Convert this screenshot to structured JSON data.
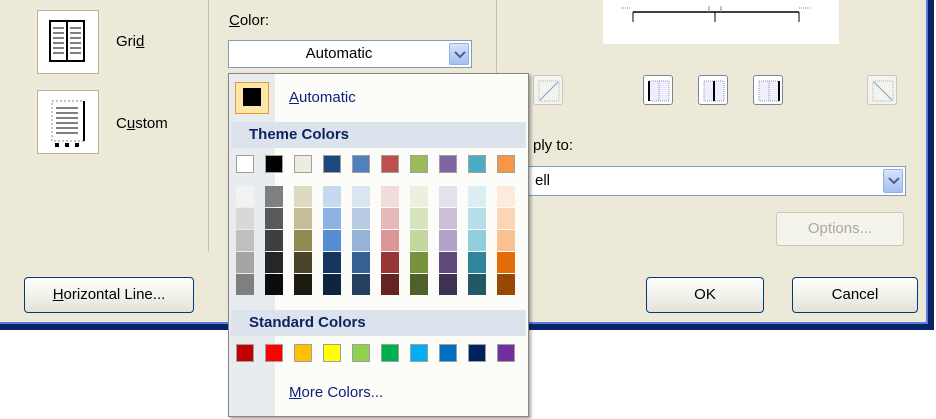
{
  "setting": {
    "grid_label": "Grid",
    "grid_mnemonic": "d",
    "custom_label": "Custom",
    "custom_mnemonic": "u"
  },
  "style": {
    "color_label": "Color:",
    "color_value": "Automatic"
  },
  "apply": {
    "label_visible": "ply to:",
    "value_visible": "ell"
  },
  "buttons": {
    "options": "Options...",
    "horizontal_line": "Horizontal Line...",
    "ok": "OK",
    "cancel": "Cancel"
  },
  "palette": {
    "automatic_label": "Automatic",
    "theme_header": "Theme Colors",
    "standard_header": "Standard Colors",
    "more_colors_label": "More Colors...",
    "theme_top_row": [
      "#ffffff",
      "#000000",
      "#eeece1",
      "#1f497d",
      "#4f81bd",
      "#c0504d",
      "#9bbb59",
      "#8064a2",
      "#4bacc6",
      "#f79646"
    ],
    "theme_shades": [
      [
        "#f2f2f2",
        "#d8d8d8",
        "#bfbfbf",
        "#a5a5a5",
        "#7f7f7f"
      ],
      [
        "#7f7f7f",
        "#595959",
        "#3f3f3f",
        "#262626",
        "#0c0c0c"
      ],
      [
        "#ddd9c3",
        "#c4bd97",
        "#938953",
        "#494429",
        "#1d1b10"
      ],
      [
        "#c6d9f0",
        "#8db3e2",
        "#548dd4",
        "#17365d",
        "#0f243e"
      ],
      [
        "#dbe5f1",
        "#b8cce4",
        "#95b3d7",
        "#366092",
        "#244061"
      ],
      [
        "#f2dcdb",
        "#e5b9b7",
        "#d99694",
        "#953734",
        "#632423"
      ],
      [
        "#ebf1dd",
        "#d7e3bc",
        "#c3d69b",
        "#76923c",
        "#4f6128"
      ],
      [
        "#e5e0ec",
        "#ccc1d9",
        "#b2a2c7",
        "#5f497a",
        "#3f3151"
      ],
      [
        "#dbeef3",
        "#b7dde8",
        "#92cddc",
        "#31859b",
        "#205867"
      ],
      [
        "#fdeada",
        "#fbd5b5",
        "#fac08f",
        "#e36c09",
        "#974806"
      ]
    ],
    "standard_colors": [
      "#c00000",
      "#ff0000",
      "#ffc000",
      "#ffff00",
      "#92d050",
      "#00b050",
      "#00b0f0",
      "#0070c0",
      "#002060",
      "#7030a0"
    ]
  }
}
